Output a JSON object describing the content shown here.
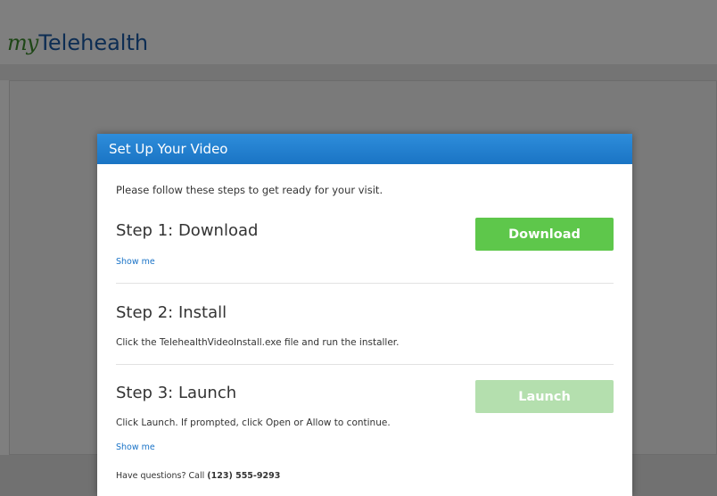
{
  "app": {
    "logo_my": "my",
    "logo_rest": "Telehealth"
  },
  "modal": {
    "title": "Set Up Your Video",
    "intro": "Please follow these steps to get ready for your visit.",
    "steps": [
      {
        "title": "Step 1: Download",
        "button_label": "Download",
        "show_me": "Show me"
      },
      {
        "title": "Step 2: Install",
        "description": "Click the TelehealthVideoInstall.exe file and run the installer."
      },
      {
        "title": "Step 3: Launch",
        "button_label": "Launch",
        "description": "Click Launch. If prompted, click Open or Allow to continue.",
        "show_me": "Show me"
      }
    ],
    "questions_text": "Have questions? Call ",
    "phone": "(123) 555-9293"
  },
  "colors": {
    "header_blue": "#1a74c4",
    "download_green": "#5ec74b",
    "launch_green_disabled": "#b4dfae",
    "link_blue": "#1a73c7",
    "logo_green": "#3d8c2c",
    "logo_blue": "#1a5aa6"
  }
}
